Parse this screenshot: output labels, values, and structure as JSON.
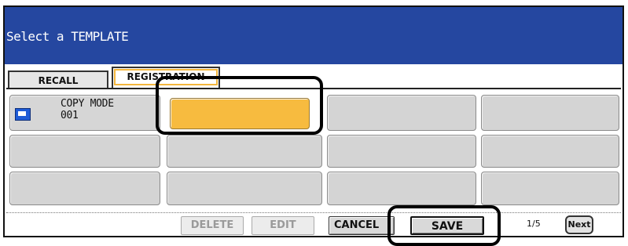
{
  "header": {
    "title": "Select a TEMPLATE",
    "background_color": "#2547a0"
  },
  "tabs": {
    "recall_label": "RECALL",
    "registration_label": "REGISTRATION",
    "active": "REGISTRATION"
  },
  "templates": {
    "slot_1": {
      "icon": "copy-mode-icon",
      "line1": "COPY MODE",
      "line2": "001"
    },
    "selected_slot": 2,
    "selected_color": "#f7bb3f"
  },
  "footer": {
    "delete_label": "DELETE",
    "edit_label": "EDIT",
    "cancel_label": "CANCEL",
    "save_label": "SAVE",
    "page_indicator": "1/5",
    "next_label": "Next"
  }
}
